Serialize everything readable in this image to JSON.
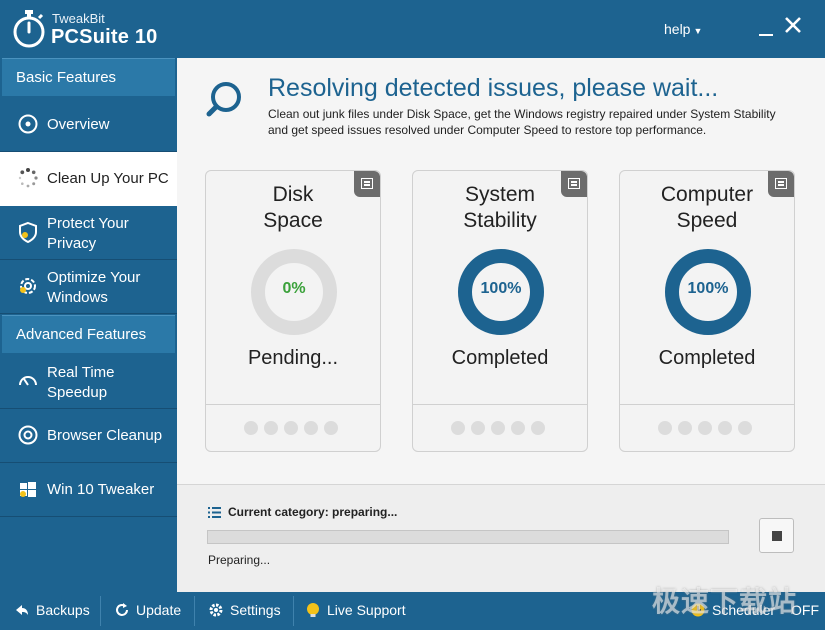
{
  "titlebar": {
    "brand_small": "TweakBit",
    "brand_big": "PCSuite 10",
    "help_label": "help",
    "icons": [
      "stopwatch-icon",
      "minimize-icon",
      "close-icon"
    ]
  },
  "sidebar": {
    "basic_header": "Basic Features",
    "advanced_header": "Advanced Features",
    "items": [
      {
        "label": "Overview",
        "icon": "overview-icon"
      },
      {
        "label": "Clean Up Your PC",
        "icon": "spinner-icon",
        "active": true
      },
      {
        "label": "Protect Your Privacy",
        "icon": "shield-icon"
      },
      {
        "label": "Optimize Your Windows",
        "icon": "optimize-icon"
      },
      {
        "label": "Real Time Speedup",
        "icon": "gauge-icon"
      },
      {
        "label": "Browser Cleanup",
        "icon": "browser-icon"
      },
      {
        "label": "Win 10 Tweaker",
        "icon": "windows-icon"
      }
    ]
  },
  "main": {
    "title": "Resolving detected issues, please wait...",
    "description": "Clean out junk files under Disk Space, get the Windows registry repaired under System Stability and get speed issues resolved under Computer Speed to restore top performance.",
    "cards": [
      {
        "title_line1": "Disk",
        "title_line2": "Space",
        "percent": "0%",
        "progress": 0,
        "status": "Pending...",
        "percent_color": "#3aa13a"
      },
      {
        "title_line1": "System",
        "title_line2": "Stability",
        "percent": "100%",
        "progress": 100,
        "status": "Completed",
        "percent_color": "#1d6390"
      },
      {
        "title_line1": "Computer",
        "title_line2": "Speed",
        "percent": "100%",
        "progress": 100,
        "status": "Completed",
        "percent_color": "#1d6390"
      }
    ],
    "current_category": "Current category: preparing...",
    "progress_value": 0,
    "preparing_text": "Preparing..."
  },
  "bottombar": {
    "backups": "Backups",
    "update": "Update",
    "settings": "Settings",
    "live_support": "Live Support",
    "scheduler": "Scheduler",
    "scheduler_state": "OFF"
  },
  "watermark": "极速下载站",
  "colors": {
    "accent": "#1d6390",
    "highlight": "#2b79a8",
    "ring_empty": "#dcdcdc",
    "success": "#3aa13a"
  }
}
